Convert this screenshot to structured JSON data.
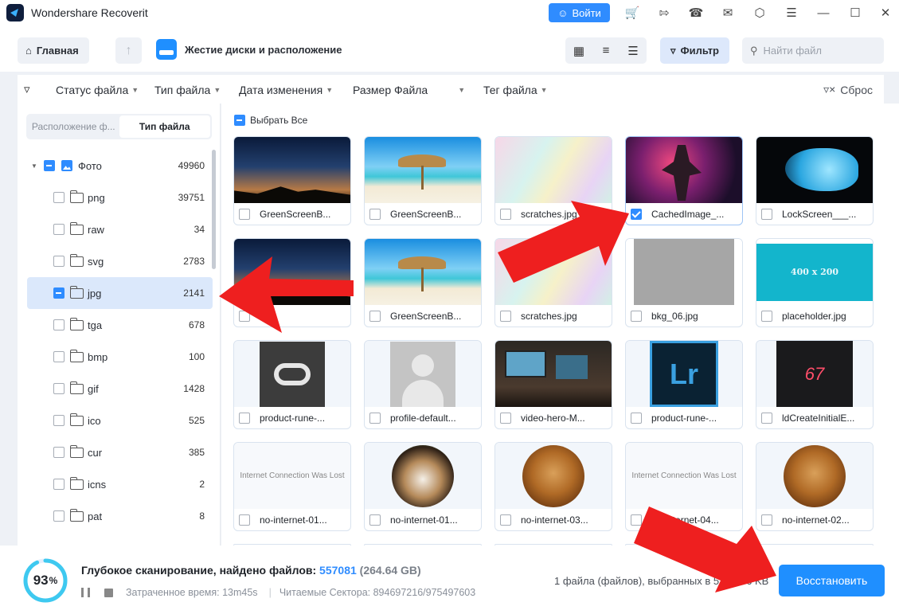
{
  "app": {
    "title": "Wondershare Recoverit",
    "login_label": "Войти"
  },
  "titlebar_icons": [
    "cart-icon",
    "export-icon",
    "headset-icon",
    "mail-icon",
    "cube-icon",
    "checklist-icon",
    "minimize-icon",
    "maximize-icon",
    "close-icon"
  ],
  "toolbar": {
    "home_label": "Главная",
    "location_label": "Жестие диски и расположение",
    "filter_label": "Фильтр",
    "search_placeholder": "Найти файл"
  },
  "filterbar": {
    "items": [
      "Статус файла",
      "Тип файла",
      "Дата изменения",
      "Размер Файла",
      "Тег файла"
    ],
    "reset_label": "Сброс"
  },
  "sidebar": {
    "tabs": [
      "Расположение ф...",
      "Тип файла"
    ],
    "active_tab": 1,
    "root": {
      "label": "Фото",
      "count": "49960"
    },
    "items": [
      {
        "label": "png",
        "count": "39751"
      },
      {
        "label": "raw",
        "count": "34"
      },
      {
        "label": "svg",
        "count": "2783"
      },
      {
        "label": "jpg",
        "count": "2141",
        "selected": true
      },
      {
        "label": "tga",
        "count": "678"
      },
      {
        "label": "bmp",
        "count": "100"
      },
      {
        "label": "gif",
        "count": "1428"
      },
      {
        "label": "ico",
        "count": "525"
      },
      {
        "label": "cur",
        "count": "385"
      },
      {
        "label": "icns",
        "count": "2"
      },
      {
        "label": "pat",
        "count": "8"
      }
    ]
  },
  "grid": {
    "select_all_label": "Выбрать Все",
    "files": [
      {
        "name": "GreenScreenB...",
        "thumb": "night-sky",
        "checked": false
      },
      {
        "name": "GreenScreenB...",
        "thumb": "beach",
        "checked": false
      },
      {
        "name": "scratches.jpg",
        "thumb": "scratches",
        "checked": false
      },
      {
        "name": "CachedImage_...",
        "thumb": "neon-figure",
        "checked": true
      },
      {
        "name": "LockScreen___...",
        "thumb": "cave",
        "checked": false
      },
      {
        "name": "",
        "thumb": "night-sky",
        "checked": false
      },
      {
        "name": "GreenScreenB...",
        "thumb": "beach",
        "checked": false
      },
      {
        "name": "scratches.jpg",
        "thumb": "scratches",
        "checked": false
      },
      {
        "name": "bkg_06.jpg",
        "thumb": "gray",
        "checked": false
      },
      {
        "name": "placeholder.jpg",
        "thumb": "placeholder",
        "thumb_text": "400 x 200",
        "checked": false
      },
      {
        "name": "product-rune-...",
        "thumb": "creative-cloud",
        "checked": false
      },
      {
        "name": "profile-default...",
        "thumb": "profile",
        "checked": false
      },
      {
        "name": "video-hero-M...",
        "thumb": "laptop",
        "checked": false
      },
      {
        "name": "product-rune-...",
        "thumb": "lightroom",
        "thumb_text": "Lr",
        "checked": false
      },
      {
        "name": "ldCreateInitialE...",
        "thumb": "dark-67",
        "thumb_text": "67",
        "checked": false
      },
      {
        "name": "no-internet-01...",
        "thumb": "no-internet",
        "thumb_text": "Internet Connection Was Lost",
        "checked": false
      },
      {
        "name": "no-internet-01...",
        "thumb": "dog-basset",
        "checked": false
      },
      {
        "name": "no-internet-03...",
        "thumb": "dog-brown",
        "checked": false
      },
      {
        "name": "no-internet-04...",
        "thumb": "no-internet",
        "thumb_text": "Internet Connection Was Lost",
        "checked": false
      },
      {
        "name": "no-internet-02...",
        "thumb": "dog-brown",
        "checked": false
      }
    ]
  },
  "scan": {
    "percent": 93,
    "percent_label": "93",
    "percent_sign": "%",
    "title": "Глубокое сканирование, найдено файлов:",
    "count": "557081",
    "size": "(264.64 GB)",
    "elapsed": "Затраченное время: 13m45s",
    "sectors": "Читаемые Сектора: 894697216/975497603"
  },
  "footer": {
    "selection_info": "1 файла (файлов), выбранных в 5",
    "selection_size": "6 KB",
    "recover_label": "Восстановить"
  },
  "colors": {
    "accent": "#2f8cff",
    "arrow": "#ee1f1f"
  }
}
